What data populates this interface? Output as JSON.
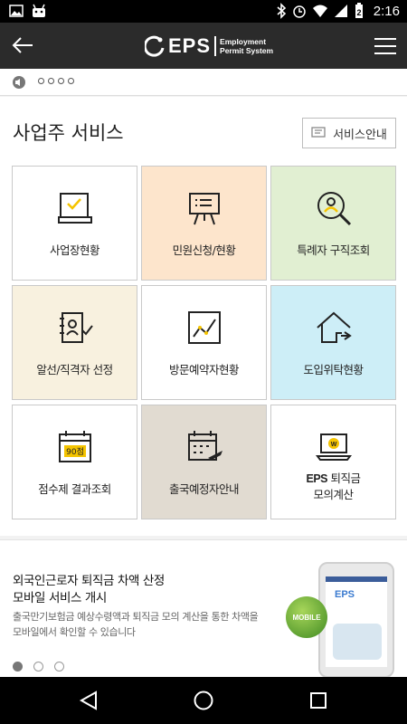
{
  "status_bar": {
    "time": "2:16",
    "battery_level": "2"
  },
  "header": {
    "logo_mark": "EPS",
    "logo_line1": "Employment",
    "logo_line2": "Permit System"
  },
  "service": {
    "title": "사업주 서비스",
    "guide_button": "서비스안내",
    "tiles": [
      {
        "label": "사업장현황",
        "bg": "#ffffff",
        "icon": "certificate-icon"
      },
      {
        "label": "민원신청/현황",
        "bg": "#fde5cc",
        "icon": "presentation-board-icon"
      },
      {
        "label": "특례자 구직조회",
        "bg": "#e1efd2",
        "icon": "person-search-icon"
      },
      {
        "label": "알선/직격자 선정",
        "bg": "#f8f1df",
        "icon": "contact-check-icon"
      },
      {
        "label": "방문예약자현황",
        "bg": "#ffffff",
        "icon": "line-chart-icon"
      },
      {
        "label": "도입위탁현황",
        "bg": "#cdeef7",
        "icon": "house-icon"
      },
      {
        "label": "점수제 결과조회",
        "bg": "#ffffff",
        "icon": "score-calendar-icon",
        "badge": "90점"
      },
      {
        "label": "출국예정자안내",
        "bg": "#e1dbd1",
        "icon": "departure-calendar-icon"
      },
      {
        "label_bold": "EPS",
        "label_rest": "퇴직금",
        "label_line2": "모의계산",
        "bg": "#ffffff",
        "icon": "laptop-won-icon"
      }
    ]
  },
  "banner": {
    "title_line1": "외국인근로자 퇴직금 차액 산정",
    "title_line2": "모바일 서비스 개시",
    "desc": "출국만기보험금 예상수령액과 퇴직금 모의 계산을 통한 차액을 모바일에서 확인할 수 있습니다",
    "badge": "MOBILE",
    "phone_logo": "EPS",
    "pager_count": 3,
    "pager_active": 0
  },
  "colors": {
    "accent_yellow": "#f5c400",
    "appbar": "#2b2b2b"
  }
}
